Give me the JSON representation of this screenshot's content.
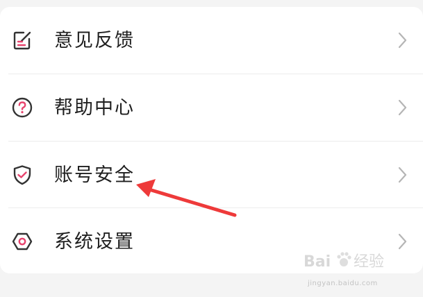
{
  "menu": {
    "items": [
      {
        "label": "意见反馈",
        "icon": "feedback-edit-icon"
      },
      {
        "label": "帮助中心",
        "icon": "help-question-icon"
      },
      {
        "label": "账号安全",
        "icon": "shield-check-icon"
      },
      {
        "label": "系统设置",
        "icon": "settings-hexagon-icon"
      }
    ]
  },
  "colors": {
    "accent": "#e8436d",
    "icon_stroke": "#333333",
    "chevron": "#b5b5b5",
    "annotation_arrow": "#ee3a3a"
  },
  "watermark": {
    "brand": "Bai",
    "brand_cn": "经验",
    "url": "jingyan.baidu.com"
  }
}
